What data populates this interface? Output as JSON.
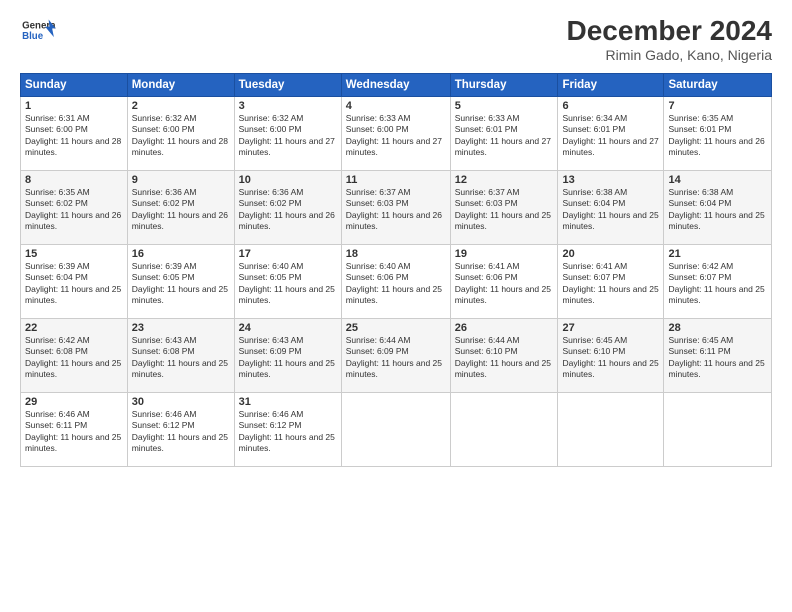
{
  "header": {
    "logo_line1": "General",
    "logo_line2": "Blue",
    "month": "December 2024",
    "location": "Rimin Gado, Kano, Nigeria"
  },
  "days_of_week": [
    "Sunday",
    "Monday",
    "Tuesday",
    "Wednesday",
    "Thursday",
    "Friday",
    "Saturday"
  ],
  "weeks": [
    [
      {
        "day": "1",
        "sunrise": "6:31 AM",
        "sunset": "6:00 PM",
        "daylight": "11 hours and 28 minutes."
      },
      {
        "day": "2",
        "sunrise": "6:32 AM",
        "sunset": "6:00 PM",
        "daylight": "11 hours and 28 minutes."
      },
      {
        "day": "3",
        "sunrise": "6:32 AM",
        "sunset": "6:00 PM",
        "daylight": "11 hours and 27 minutes."
      },
      {
        "day": "4",
        "sunrise": "6:33 AM",
        "sunset": "6:00 PM",
        "daylight": "11 hours and 27 minutes."
      },
      {
        "day": "5",
        "sunrise": "6:33 AM",
        "sunset": "6:01 PM",
        "daylight": "11 hours and 27 minutes."
      },
      {
        "day": "6",
        "sunrise": "6:34 AM",
        "sunset": "6:01 PM",
        "daylight": "11 hours and 27 minutes."
      },
      {
        "day": "7",
        "sunrise": "6:35 AM",
        "sunset": "6:01 PM",
        "daylight": "11 hours and 26 minutes."
      }
    ],
    [
      {
        "day": "8",
        "sunrise": "6:35 AM",
        "sunset": "6:02 PM",
        "daylight": "11 hours and 26 minutes."
      },
      {
        "day": "9",
        "sunrise": "6:36 AM",
        "sunset": "6:02 PM",
        "daylight": "11 hours and 26 minutes."
      },
      {
        "day": "10",
        "sunrise": "6:36 AM",
        "sunset": "6:02 PM",
        "daylight": "11 hours and 26 minutes."
      },
      {
        "day": "11",
        "sunrise": "6:37 AM",
        "sunset": "6:03 PM",
        "daylight": "11 hours and 26 minutes."
      },
      {
        "day": "12",
        "sunrise": "6:37 AM",
        "sunset": "6:03 PM",
        "daylight": "11 hours and 25 minutes."
      },
      {
        "day": "13",
        "sunrise": "6:38 AM",
        "sunset": "6:04 PM",
        "daylight": "11 hours and 25 minutes."
      },
      {
        "day": "14",
        "sunrise": "6:38 AM",
        "sunset": "6:04 PM",
        "daylight": "11 hours and 25 minutes."
      }
    ],
    [
      {
        "day": "15",
        "sunrise": "6:39 AM",
        "sunset": "6:04 PM",
        "daylight": "11 hours and 25 minutes."
      },
      {
        "day": "16",
        "sunrise": "6:39 AM",
        "sunset": "6:05 PM",
        "daylight": "11 hours and 25 minutes."
      },
      {
        "day": "17",
        "sunrise": "6:40 AM",
        "sunset": "6:05 PM",
        "daylight": "11 hours and 25 minutes."
      },
      {
        "day": "18",
        "sunrise": "6:40 AM",
        "sunset": "6:06 PM",
        "daylight": "11 hours and 25 minutes."
      },
      {
        "day": "19",
        "sunrise": "6:41 AM",
        "sunset": "6:06 PM",
        "daylight": "11 hours and 25 minutes."
      },
      {
        "day": "20",
        "sunrise": "6:41 AM",
        "sunset": "6:07 PM",
        "daylight": "11 hours and 25 minutes."
      },
      {
        "day": "21",
        "sunrise": "6:42 AM",
        "sunset": "6:07 PM",
        "daylight": "11 hours and 25 minutes."
      }
    ],
    [
      {
        "day": "22",
        "sunrise": "6:42 AM",
        "sunset": "6:08 PM",
        "daylight": "11 hours and 25 minutes."
      },
      {
        "day": "23",
        "sunrise": "6:43 AM",
        "sunset": "6:08 PM",
        "daylight": "11 hours and 25 minutes."
      },
      {
        "day": "24",
        "sunrise": "6:43 AM",
        "sunset": "6:09 PM",
        "daylight": "11 hours and 25 minutes."
      },
      {
        "day": "25",
        "sunrise": "6:44 AM",
        "sunset": "6:09 PM",
        "daylight": "11 hours and 25 minutes."
      },
      {
        "day": "26",
        "sunrise": "6:44 AM",
        "sunset": "6:10 PM",
        "daylight": "11 hours and 25 minutes."
      },
      {
        "day": "27",
        "sunrise": "6:45 AM",
        "sunset": "6:10 PM",
        "daylight": "11 hours and 25 minutes."
      },
      {
        "day": "28",
        "sunrise": "6:45 AM",
        "sunset": "6:11 PM",
        "daylight": "11 hours and 25 minutes."
      }
    ],
    [
      {
        "day": "29",
        "sunrise": "6:46 AM",
        "sunset": "6:11 PM",
        "daylight": "11 hours and 25 minutes."
      },
      {
        "day": "30",
        "sunrise": "6:46 AM",
        "sunset": "6:12 PM",
        "daylight": "11 hours and 25 minutes."
      },
      {
        "day": "31",
        "sunrise": "6:46 AM",
        "sunset": "6:12 PM",
        "daylight": "11 hours and 25 minutes."
      },
      null,
      null,
      null,
      null
    ]
  ]
}
